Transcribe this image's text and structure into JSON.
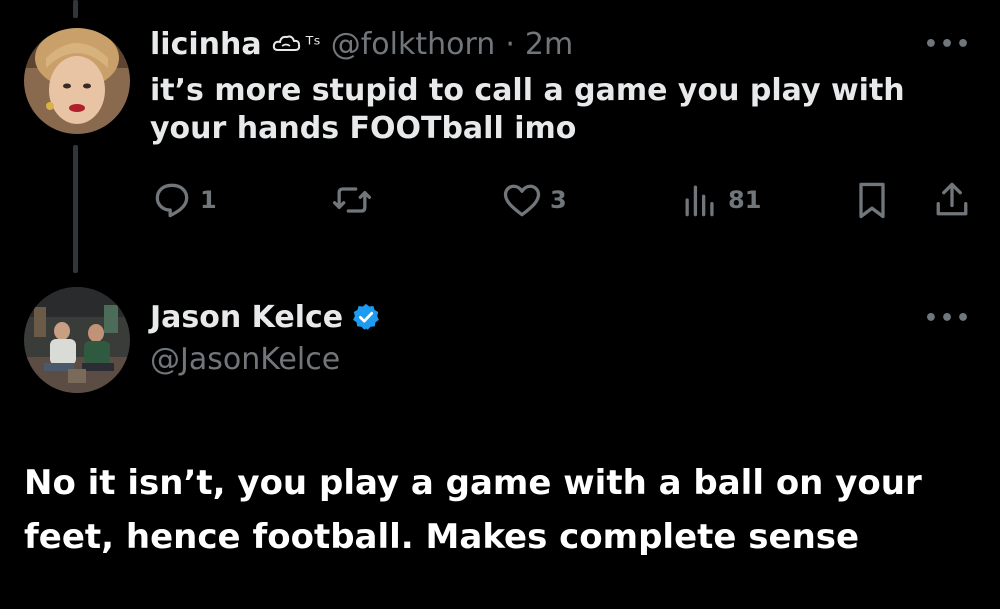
{
  "reply": {
    "display_name": "licinha",
    "name_badge": "ᵀˢ",
    "handle": "@folkthorn",
    "separator": "·",
    "timestamp": "2m",
    "text": "it’s more stupid to call a game you play with your hands FOOTball imo",
    "more_label": "•••",
    "actions": {
      "replies": "1",
      "retweets": "",
      "likes": "3",
      "views": "81"
    }
  },
  "post": {
    "display_name": "Jason Kelce",
    "handle": "@JasonKelce",
    "verified": true,
    "more_label": "•••",
    "text": "No it isn’t, you play a game with a ball on your feet, hence football.  Makes complete sense"
  },
  "colors": {
    "background": "#000000",
    "text": "#e7e9ea",
    "muted": "#71767b",
    "verified": "#1d9bf0",
    "thread_line": "#333639"
  }
}
